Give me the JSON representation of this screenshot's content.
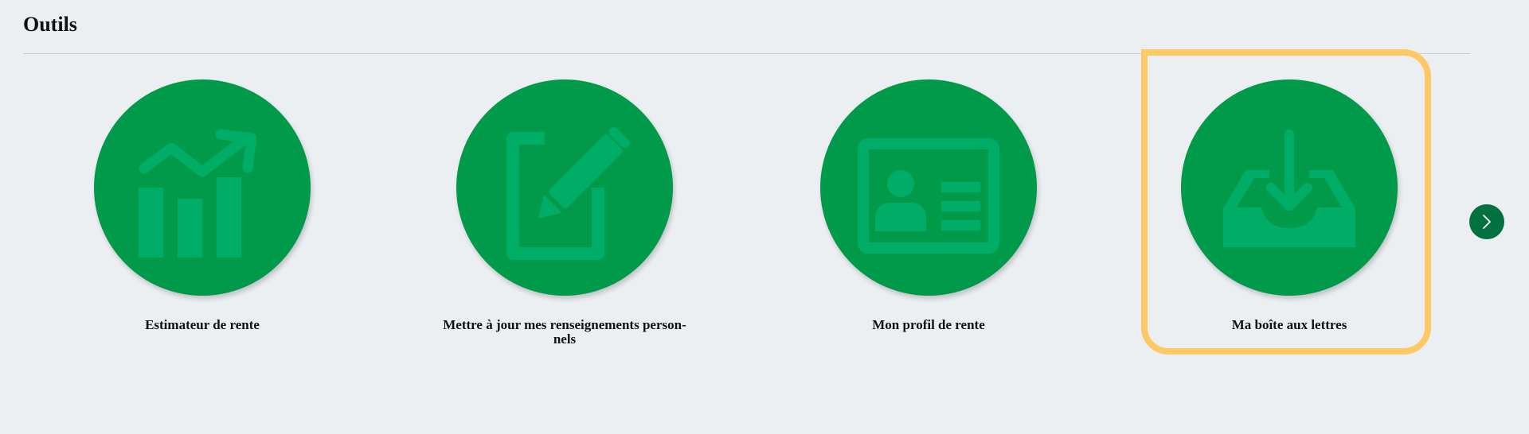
{
  "section": {
    "title": "Outils"
  },
  "tools": [
    {
      "label": "Estimateur de rente",
      "icon": "chart-growth-icon"
    },
    {
      "label": "Mettre à jour mes renseignements person-\nnels",
      "icon": "edit-document-icon"
    },
    {
      "label": "Mon profil de rente",
      "icon": "id-card-icon"
    },
    {
      "label": "Ma boîte aux lettres",
      "icon": "inbox-download-icon"
    }
  ],
  "carousel": {
    "next_icon": "chevron-right-icon"
  },
  "colors": {
    "background": "#ebeff2",
    "circle": "#009a4a",
    "glyph": "#00ad66",
    "focus": "#fdc966",
    "next_button": "#00713f"
  }
}
